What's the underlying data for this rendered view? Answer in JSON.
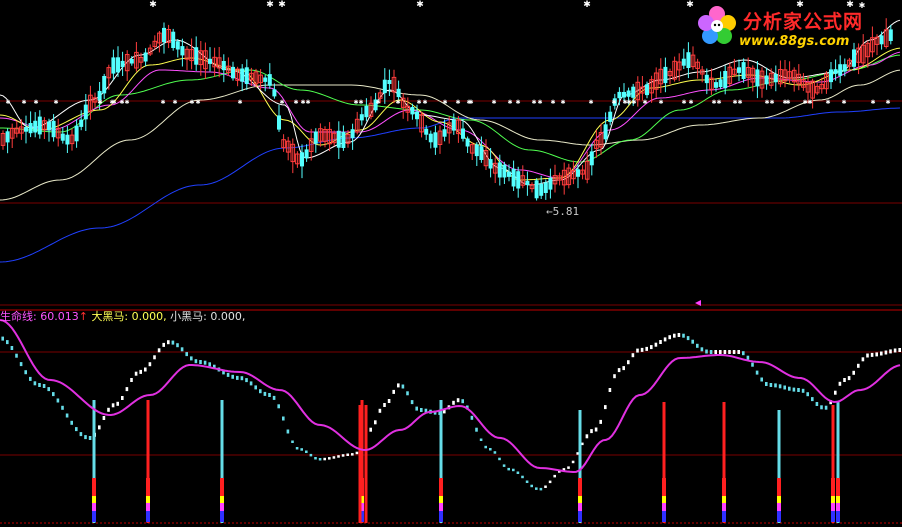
{
  "indicator_legend": {
    "line1_name": "生命线:",
    "line1_value": "60.013",
    "line1_arrow": "↑",
    "line2_name": "大黑马:",
    "line2_value": "0.000,",
    "line3_name": "小黑马:",
    "line3_value": "0.000,"
  },
  "low_price_label": "5.81",
  "watermark": {
    "title": "分析家公式网",
    "url": "www.88gs.com"
  },
  "colors": {
    "up_candle": "#ff3c3c",
    "down_candle": "#54ffff",
    "ma_white": "#ffffff",
    "ma_yellow": "#ffff50",
    "ma_magenta": "#ff50ff",
    "ma_green": "#50ff50",
    "ma_long": "#e8e8c8",
    "ma_blue": "#2040ff",
    "lifeline": "#e030e0",
    "grid_red": "#7a0000"
  }
}
